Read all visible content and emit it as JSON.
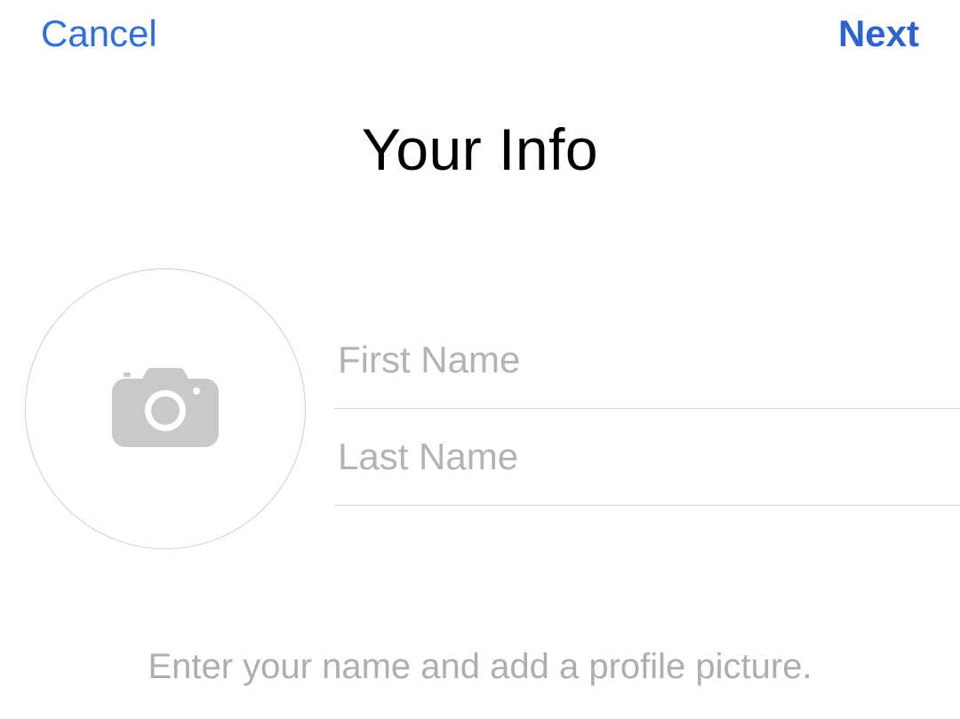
{
  "nav": {
    "cancel_label": "Cancel",
    "next_label": "Next"
  },
  "title": "Your Info",
  "fields": {
    "first_name": {
      "placeholder": "First Name",
      "value": ""
    },
    "last_name": {
      "placeholder": "Last Name",
      "value": ""
    }
  },
  "avatar": {
    "icon": "camera-icon"
  },
  "helper": "Enter your name and add a profile picture."
}
